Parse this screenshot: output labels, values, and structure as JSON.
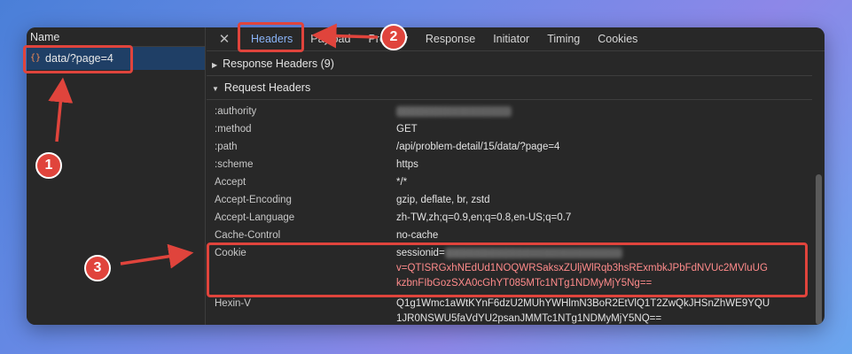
{
  "network_panel": {
    "name_column_header": "Name",
    "request": {
      "type_icon": "{}",
      "name": "data/?page=4"
    }
  },
  "tabs": [
    {
      "label": "Headers",
      "active": true
    },
    {
      "label": "Payload",
      "active": false
    },
    {
      "label": "Preview",
      "active": false
    },
    {
      "label": "Response",
      "active": false
    },
    {
      "label": "Initiator",
      "active": false
    },
    {
      "label": "Timing",
      "active": false
    },
    {
      "label": "Cookies",
      "active": false
    }
  ],
  "response_headers": {
    "label": "Response Headers (9)",
    "collapsed": true
  },
  "request_headers": {
    "label": "Request Headers",
    "rows": [
      {
        "name": ":authority",
        "value": "",
        "blurred": true
      },
      {
        "name": ":method",
        "value": "GET"
      },
      {
        "name": ":path",
        "value": "/api/problem-detail/15/data/?page=4"
      },
      {
        "name": ":scheme",
        "value": "https"
      },
      {
        "name": "Accept",
        "value": "*/*"
      },
      {
        "name": "Accept-Encoding",
        "value": "gzip, deflate, br, zstd"
      },
      {
        "name": "Accept-Language",
        "value": "zh-TW,zh;q=0.9,en;q=0.8,en-US;q=0.7"
      },
      {
        "name": "Cache-Control",
        "value": "no-cache"
      }
    ],
    "cookie": {
      "name": "Cookie",
      "prefix": "sessionid=",
      "line2": "v=QTISRGxhNEdUd1NOQWRSaksxZUljWlRqb3hsRExmbkJPbFdNVUc2MVluUG",
      "line3": "kzbnFIbGozSXA0cGhYT085MTc1NTg1NDMyMjY5Ng=="
    },
    "hexin": {
      "name": "Hexin-V",
      "line1": "Q1g1Wmc1aWtKYnF6dzU2MUhYWHlmN3BoR2EtVlQ1T2ZwQkJHSnZhWE9YQU",
      "line2": "1JR0NSWU5faVdYU2psanJMMTc1NTg1NDMyMjY5NQ=="
    }
  },
  "annotations": [
    "1",
    "2",
    "3"
  ],
  "colors": {
    "annotation": "#e0443c",
    "active_tab": "#8ab4f8",
    "cookie_value": "#ff8b8b"
  }
}
